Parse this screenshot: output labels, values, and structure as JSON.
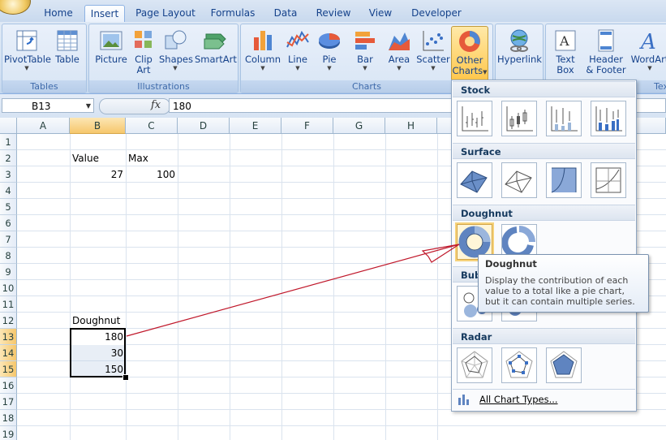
{
  "tabs": [
    "Home",
    "Insert",
    "Page Layout",
    "Formulas",
    "Data",
    "Review",
    "View",
    "Developer"
  ],
  "active_tab": "Insert",
  "ribbon": {
    "groups": {
      "tables": "Tables",
      "illustrations": "Illustrations",
      "charts": "Charts",
      "text": "Tex"
    },
    "buttons": {
      "pivottable": "PivotTable",
      "table": "Table",
      "picture": "Picture",
      "clipart_1": "Clip",
      "clipart_2": "Art",
      "shapes": "Shapes",
      "smartart": "SmartArt",
      "column": "Column",
      "line": "Line",
      "pie": "Pie",
      "bar": "Bar",
      "area": "Area",
      "scatter": "Scatter",
      "other_1": "Other",
      "other_2": "Charts",
      "hyperlink": "Hyperlink",
      "textbox_1": "Text",
      "textbox_2": "Box",
      "header_1": "Header",
      "header_2": "& Footer",
      "wordart": "WordArt"
    }
  },
  "formula_bar": {
    "name_box": "B13",
    "fx": "fx",
    "value": "180"
  },
  "columns": [
    "A",
    "B",
    "C",
    "D",
    "E",
    "F",
    "G",
    "H"
  ],
  "rows": [
    "1",
    "2",
    "3",
    "4",
    "5",
    "6",
    "7",
    "8",
    "9",
    "10",
    "11",
    "12",
    "13",
    "14",
    "15",
    "16",
    "17",
    "18",
    "19"
  ],
  "cells": {
    "B2": "Value",
    "C2": "Max",
    "B3": "27",
    "C3": "100",
    "B12": "Doughnut",
    "B13": "180",
    "B14": "30",
    "B15": "150"
  },
  "dropdown": {
    "sections": [
      "Stock",
      "Surface",
      "Doughnut",
      "Bubble",
      "Radar"
    ],
    "bubble_visible": "Bubb",
    "footer": "All Chart Types..."
  },
  "tooltip": {
    "title": "Doughnut",
    "body": "Display the contribution of each value to a total like a pie chart, but it can contain multiple series."
  },
  "colors": {
    "arrow": "#c0182b",
    "accent": "#15428b",
    "selected_header": "#f6c76c"
  }
}
